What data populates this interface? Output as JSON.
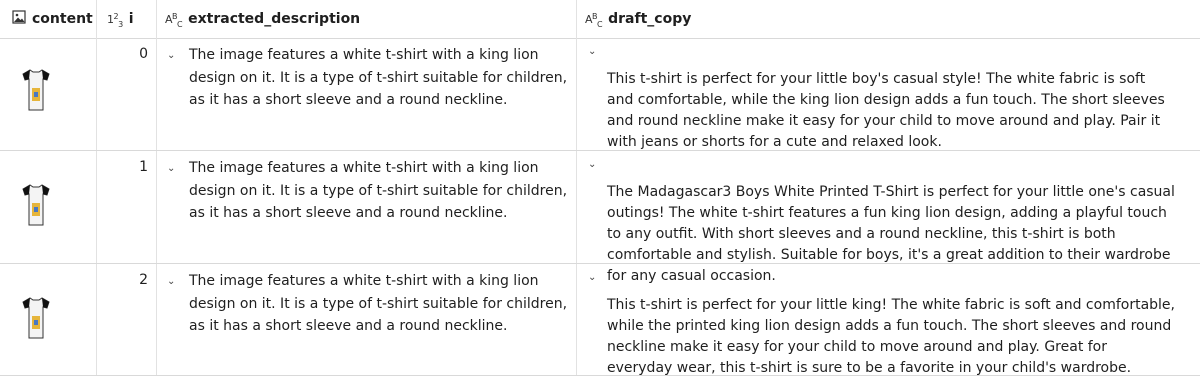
{
  "columns": {
    "content": {
      "type_icon": "image-icon",
      "label": "content"
    },
    "i": {
      "type_icon": "integer-type-icon",
      "type_text": "123",
      "label": "i"
    },
    "extracted_description": {
      "type_icon": "string-type-icon",
      "label": "extracted_description"
    },
    "draft_copy": {
      "type_icon": "string-type-icon",
      "label": "draft_copy"
    }
  },
  "rows": [
    {
      "i": "0",
      "content_icon": "tshirt-thumbnail-icon",
      "extracted_description": "The image features a white t-shirt with a king lion design on it. It is a type of t-shirt suitable for children, as it has a short sleeve and a round neckline.",
      "draft_copy": "This t-shirt is perfect for your little boy's casual style! The white fabric is soft and comfortable, while the king lion design adds a fun touch. The short sleeves and round neckline make it easy for your child to move around and play. Pair it with jeans or shorts for a cute and relaxed look."
    },
    {
      "i": "1",
      "content_icon": "tshirt-thumbnail-icon",
      "extracted_description": "The image features a white t-shirt with a king lion design on it. It is a type of t-shirt suitable for children, as it has a short sleeve and a round neckline.",
      "draft_copy": "The Madagascar3 Boys White Printed T-Shirt is perfect for your little one's casual outings! The white t-shirt features a fun king lion design, adding a playful touch to any outfit. With short sleeves and a round neckline, this t-shirt is both comfortable and stylish. Suitable for boys, it's a great addition to their wardrobe for any casual occasion."
    },
    {
      "i": "2",
      "content_icon": "tshirt-thumbnail-icon",
      "extracted_description": "The image features a white t-shirt with a king lion design on it. It is a type of t-shirt suitable for children, as it has a short sleeve and a round neckline.",
      "draft_copy": "This t-shirt is perfect for your little king! The white fabric is soft and comfortable, while the printed king lion design adds a fun touch. The short sleeves and round neckline make it easy for your child to move around and play. Great for everyday wear, this t-shirt is sure to be a favorite in your child's wardrobe."
    }
  ]
}
